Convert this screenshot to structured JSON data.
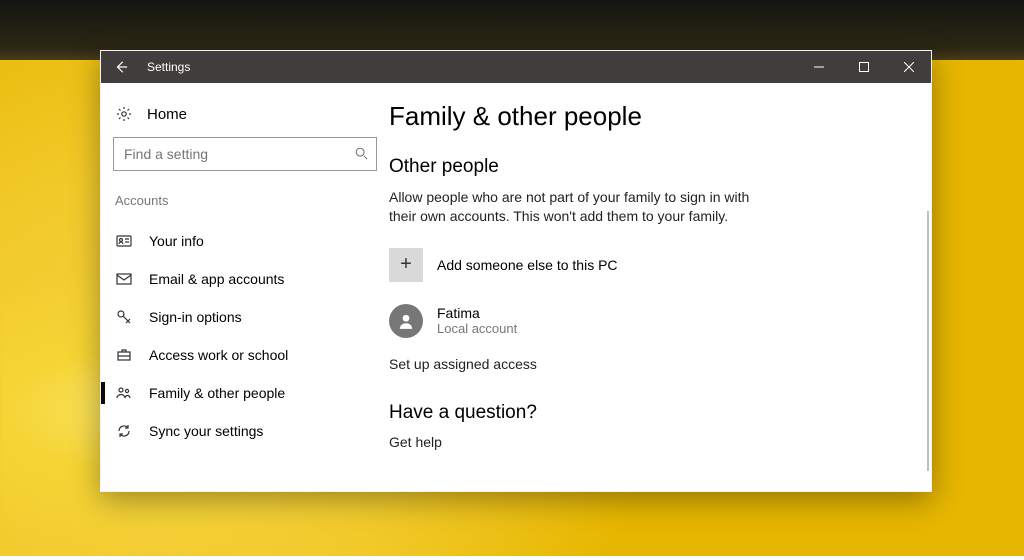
{
  "window": {
    "title": "Settings"
  },
  "sidebar": {
    "home": "Home",
    "searchPlaceholder": "Find a setting",
    "section": "Accounts",
    "items": [
      {
        "label": "Your info"
      },
      {
        "label": "Email & app accounts"
      },
      {
        "label": "Sign-in options"
      },
      {
        "label": "Access work or school"
      },
      {
        "label": "Family & other people"
      },
      {
        "label": "Sync your settings"
      }
    ]
  },
  "content": {
    "pageTitle": "Family & other people",
    "section1": {
      "heading": "Other people",
      "description": "Allow people who are not part of your family to sign in with their own accounts. This won't add them to your family.",
      "addLabel": "Add someone else to this PC",
      "user": {
        "name": "Fatima",
        "type": "Local account"
      },
      "assignedAccess": "Set up assigned access"
    },
    "section2": {
      "heading": "Have a question?",
      "helpLink": "Get help"
    }
  }
}
